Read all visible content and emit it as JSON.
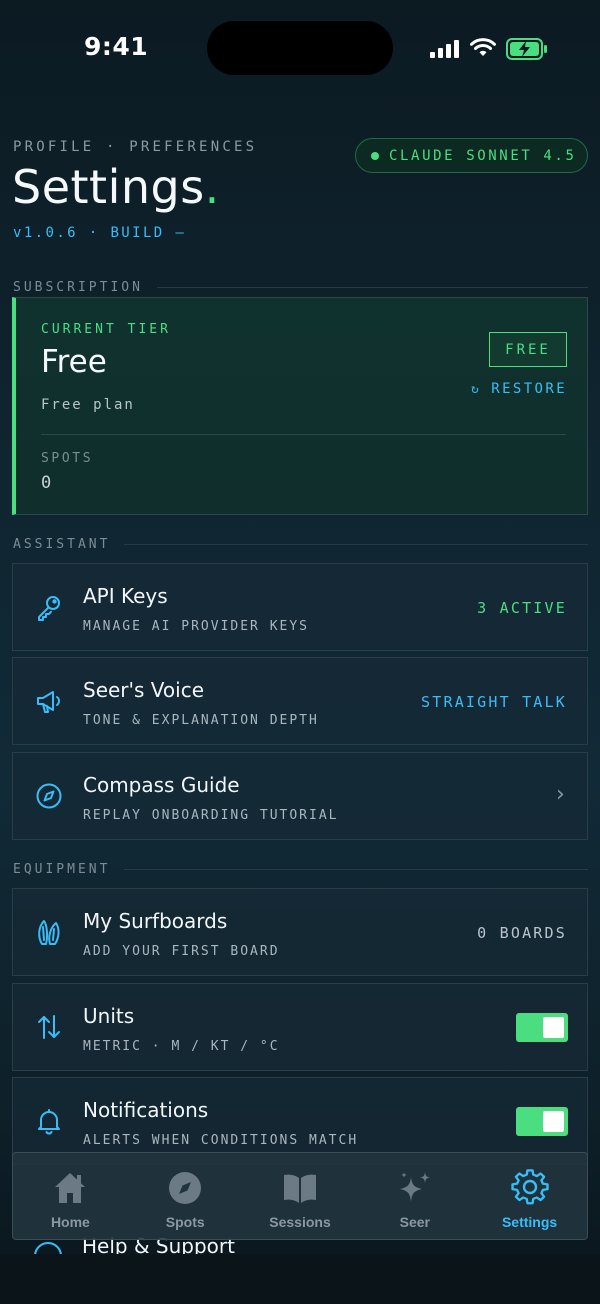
{
  "status_bar": {
    "time": "9:41"
  },
  "header": {
    "eyebrow": "PROFILE · PREFERENCES",
    "title": "Settings",
    "title_dot": ".",
    "version": "v1.0.6 · BUILD —",
    "model_pill": "CLAUDE SONNET 4.5"
  },
  "subscription": {
    "section_label": "SUBSCRIPTION",
    "tier_label": "CURRENT TIER",
    "tier_name": "Free",
    "tier_desc": "Free plan",
    "badge": "FREE",
    "restore_icon": "↻",
    "restore_label": "RESTORE",
    "spots_label": "SPOTS",
    "spots_value": "0"
  },
  "assistant": {
    "section_label": "ASSISTANT",
    "rows": [
      {
        "icon": "key-icon",
        "title": "API Keys",
        "subtitle": "MANAGE AI PROVIDER KEYS",
        "right": "3 ACTIVE",
        "right_color": "#4ade80"
      },
      {
        "icon": "megaphone-icon",
        "title": "Seer's Voice",
        "subtitle": "TONE & EXPLANATION DEPTH",
        "right": "STRAIGHT TALK",
        "right_color": "#38bdf8"
      },
      {
        "icon": "compass-icon",
        "title": "Compass Guide",
        "subtitle": "REPLAY ONBOARDING TUTORIAL",
        "right": "›",
        "right_color": "#8b98a1"
      }
    ]
  },
  "equipment": {
    "section_label": "EQUIPMENT",
    "rows": [
      {
        "icon": "surfboard-icon",
        "title": "My Surfboards",
        "subtitle": "ADD YOUR FIRST BOARD",
        "right": "0 BOARDS",
        "right_color": "#b9c5cc"
      },
      {
        "icon": "swap-arrows-icon",
        "title": "Units",
        "subtitle": "METRIC · M / KT / °C",
        "toggle_on": true
      },
      {
        "icon": "bell-icon",
        "title": "Notifications",
        "subtitle": "ALERTS WHEN CONDITIONS MATCH",
        "toggle_on": true
      }
    ]
  },
  "peek_row": {
    "title": "Help & Support"
  },
  "tabbar": {
    "tabs": [
      {
        "label": "Home",
        "icon": "home-icon",
        "active": false
      },
      {
        "label": "Spots",
        "icon": "compass-icon",
        "active": false
      },
      {
        "label": "Sessions",
        "icon": "book-icon",
        "active": false
      },
      {
        "label": "Seer",
        "icon": "sparkles-icon",
        "active": false
      },
      {
        "label": "Settings",
        "icon": "gear-icon",
        "active": true
      }
    ]
  },
  "colors": {
    "accent_green": "#4ade80",
    "accent_blue": "#38bdf8"
  }
}
